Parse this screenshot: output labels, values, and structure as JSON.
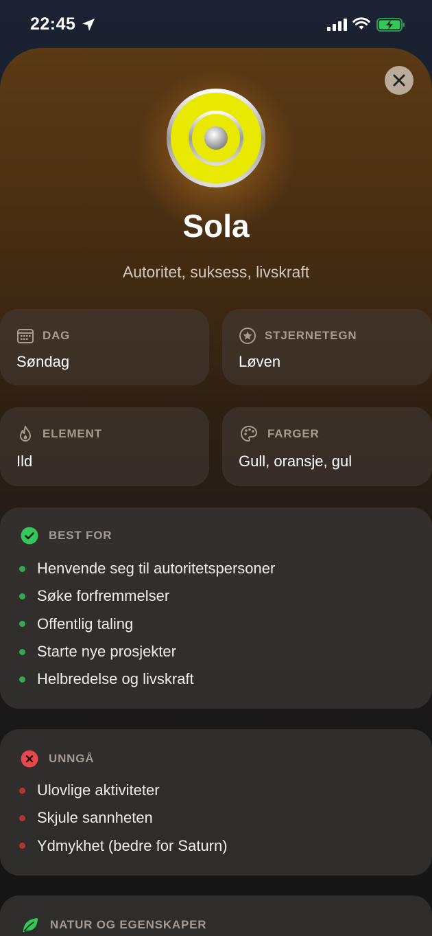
{
  "status_bar": {
    "time": "22:45"
  },
  "planet": {
    "name": "Sola",
    "subtitle": "Autoritet, suksess, livskraft"
  },
  "info_cards": {
    "day": {
      "label": "DAG",
      "value": "Søndag"
    },
    "zodiac": {
      "label": "STJERNETEGN",
      "value": "Løven"
    },
    "element": {
      "label": "ELEMENT",
      "value": "Ild"
    },
    "colors": {
      "label": "FARGER",
      "value": "Gull, oransje, gul"
    }
  },
  "best_for": {
    "label": "BEST FOR",
    "items": [
      "Henvende seg til autoritetspersoner",
      "Søke forfremmelser",
      "Offentlig taling",
      "Starte nye prosjekter",
      "Helbredelse og livskraft"
    ]
  },
  "avoid": {
    "label": "UNNGÅ",
    "items": [
      "Ulovlige aktiviteter",
      "Skjule sannheten",
      "Ydmykhet (bedre for Saturn)"
    ]
  },
  "nature": {
    "label": "NATUR OG EGENSKAPER"
  },
  "colors": {
    "accent_green": "#34c759",
    "accent_red": "#e5484d",
    "planet_yellow": "#e8e800",
    "battery_green": "#34c759"
  },
  "icons": {
    "close": "close-icon",
    "day": "calendar-icon",
    "zodiac": "star-circle-icon",
    "element": "flame-icon",
    "colors": "palette-icon",
    "best_for": "checkmark-circle-icon",
    "avoid": "x-circle-icon",
    "nature": "leaf-icon"
  }
}
